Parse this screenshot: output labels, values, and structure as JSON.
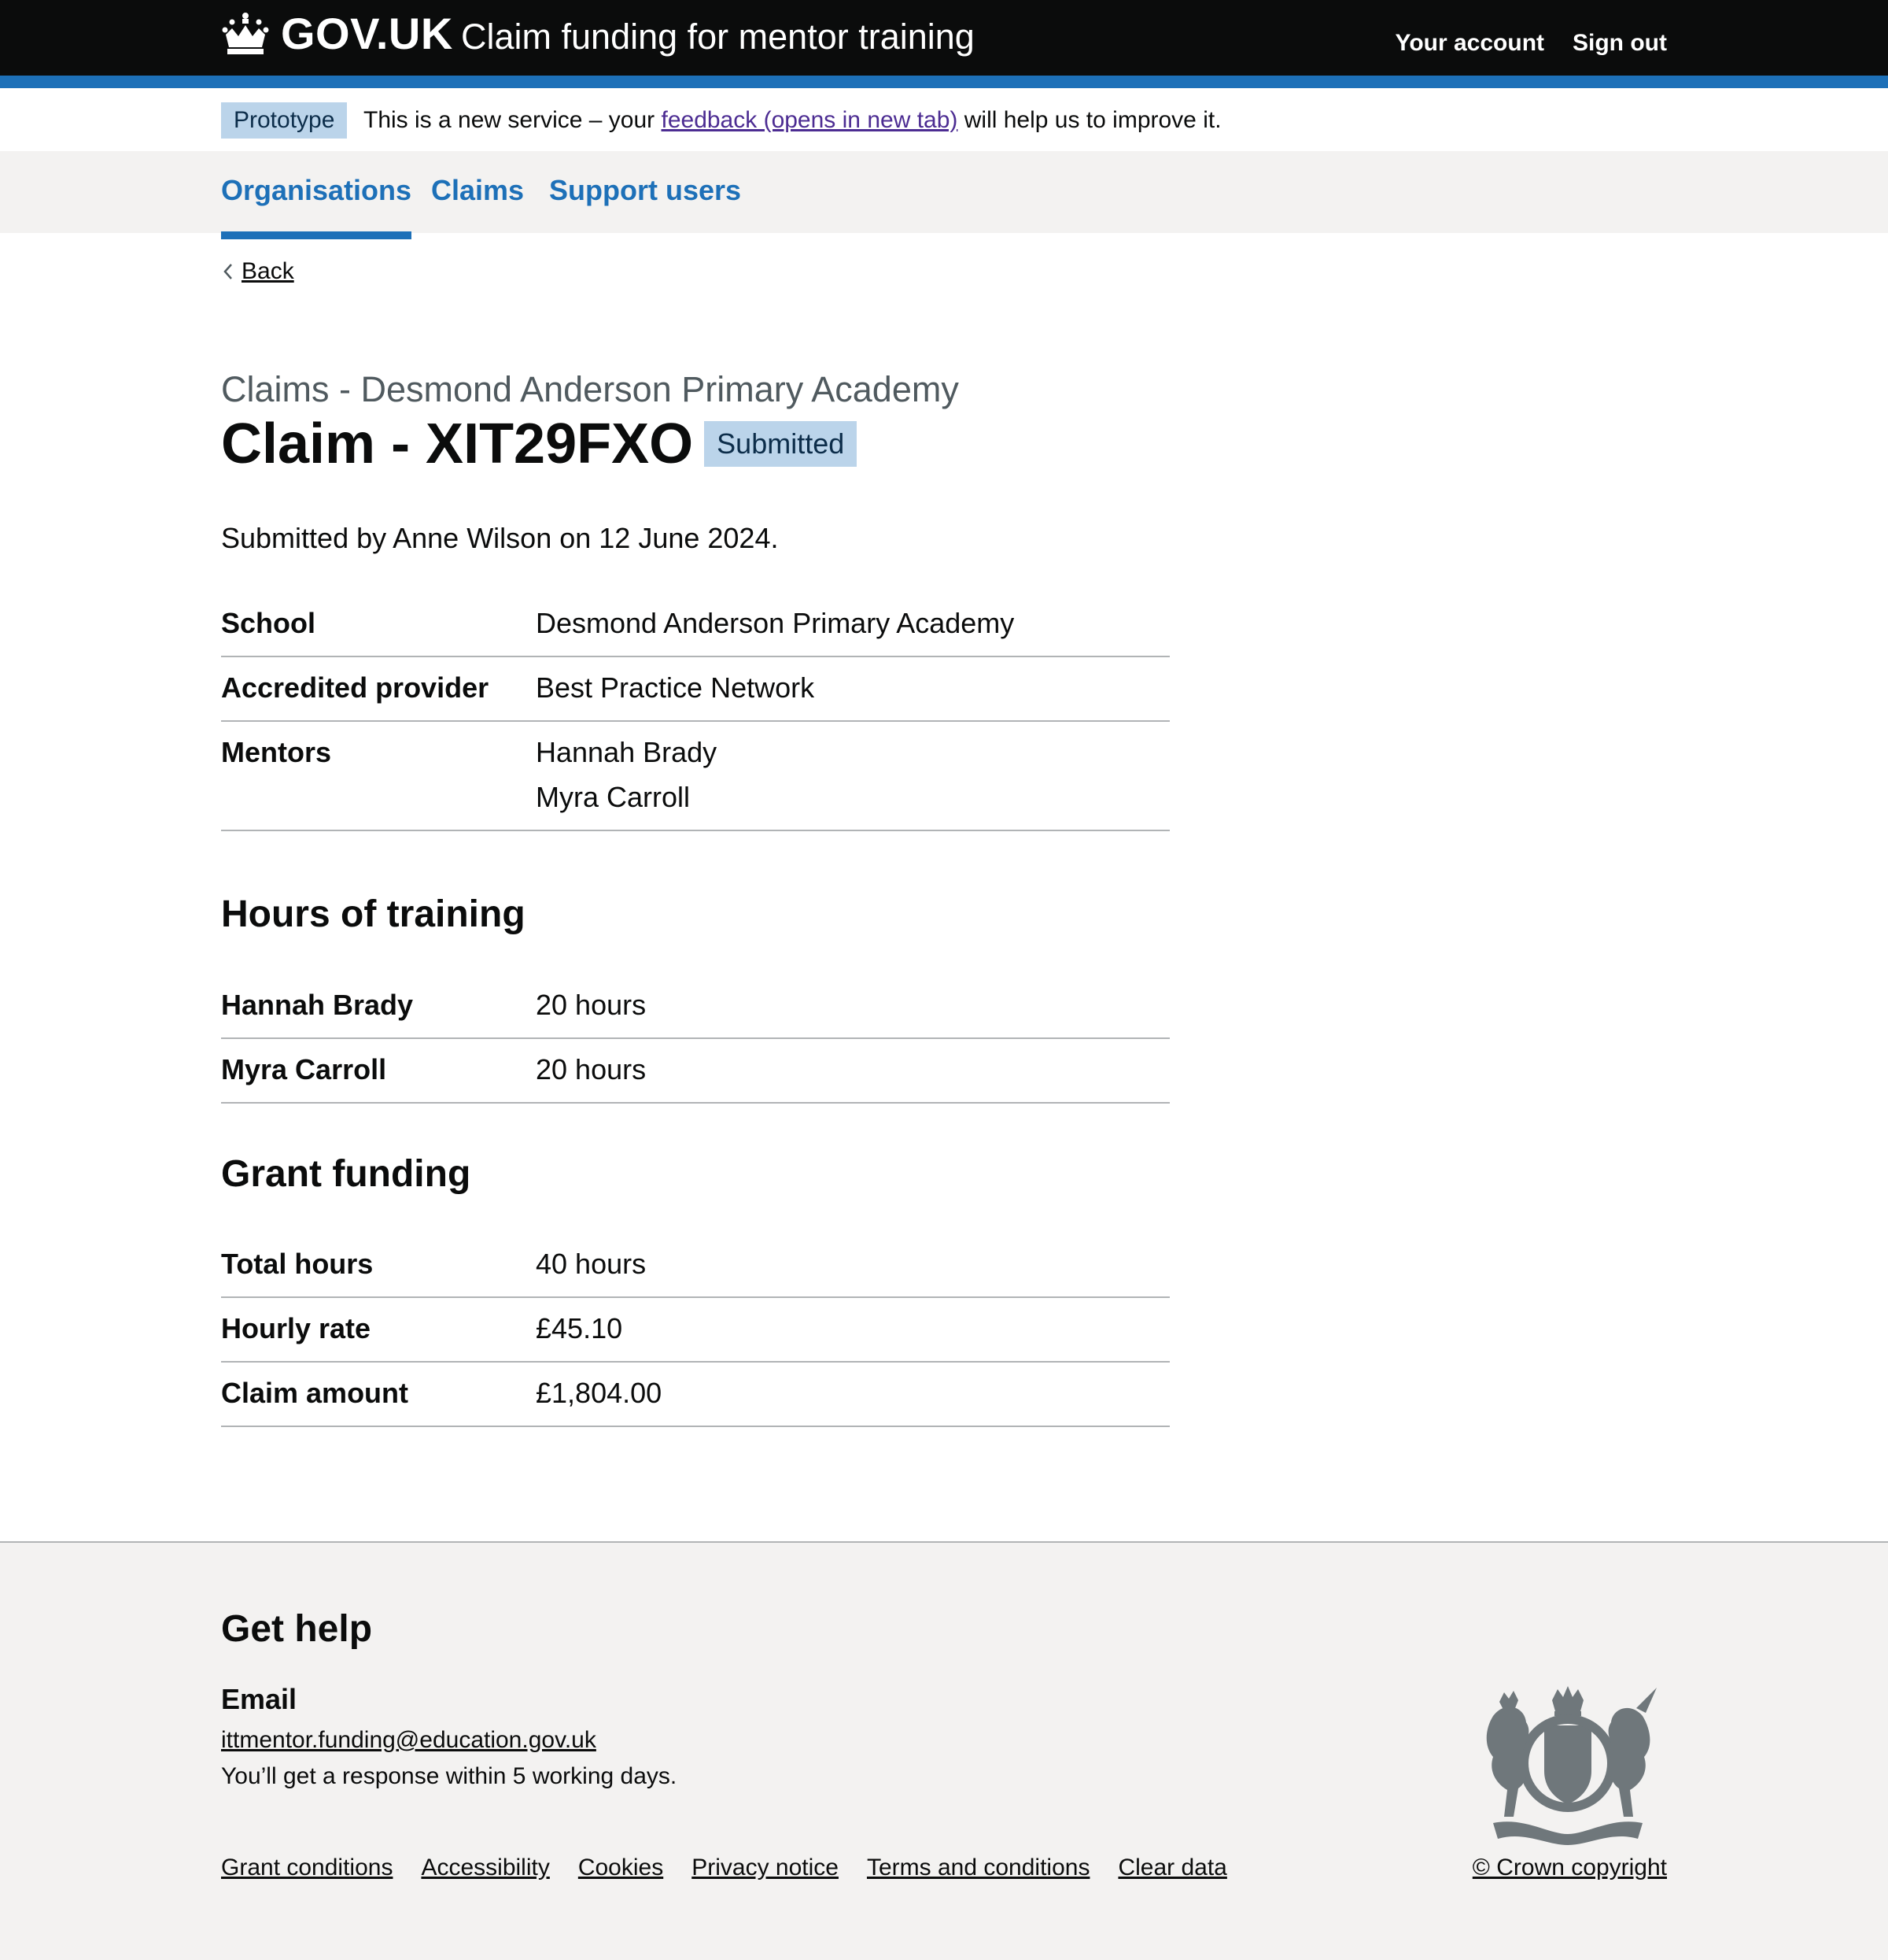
{
  "header": {
    "logo_text": "GOV.UK",
    "service_name": "Claim funding for mentor training",
    "links": [
      "Your account",
      "Sign out"
    ],
    "bg_color": "#0b0c0c",
    "accent_color": "#1d70b8"
  },
  "phase_banner": {
    "tag": "Prototype",
    "text_before": "This is a new service – your",
    "link": "feedback (opens in new tab)",
    "text_after": "will help us to improve it."
  },
  "nav": {
    "items": [
      "Organisations",
      "Claims",
      "Support users"
    ],
    "active": "Organisations"
  },
  "back_link": "Back",
  "page": {
    "caption": "Claims - Desmond Anderson Primary Academy",
    "title": "Claim - XIT29FXO",
    "status_tag": "Submitted",
    "submitted_line": "Submitted by Anne Wilson on 12 June 2024."
  },
  "claim_details": {
    "school_key": "School",
    "school_value": "Desmond Anderson Primary Academy",
    "provider_key": "Accredited provider",
    "provider_value": "Best Practice Network",
    "mentors_key": "Mentors",
    "mentors": [
      "Hannah Brady",
      "Myra Carroll"
    ]
  },
  "hours_of_training": {
    "heading": "Hours of training",
    "rows": [
      {
        "key": "Hannah Brady",
        "value": "20 hours"
      },
      {
        "key": "Myra Carroll",
        "value": "20 hours"
      }
    ]
  },
  "grant_funding": {
    "heading": "Grant funding",
    "rows": [
      {
        "key": "Total hours",
        "value": "40 hours"
      },
      {
        "key": "Hourly rate",
        "value": "£45.10"
      },
      {
        "key": "Claim amount",
        "value": "£1,804.00"
      }
    ]
  },
  "footer": {
    "heading": "Get help",
    "email_heading": "Email",
    "email": "ittmentor.funding@education.gov.uk",
    "response": "You’ll get a response within 5 working days.",
    "links": [
      "Grant conditions",
      "Accessibility",
      "Cookies",
      "Privacy notice",
      "Terms and conditions",
      "Clear data"
    ],
    "copyright": "© Crown copyright",
    "crest_icon": "royal-coat-of-arms-icon"
  }
}
